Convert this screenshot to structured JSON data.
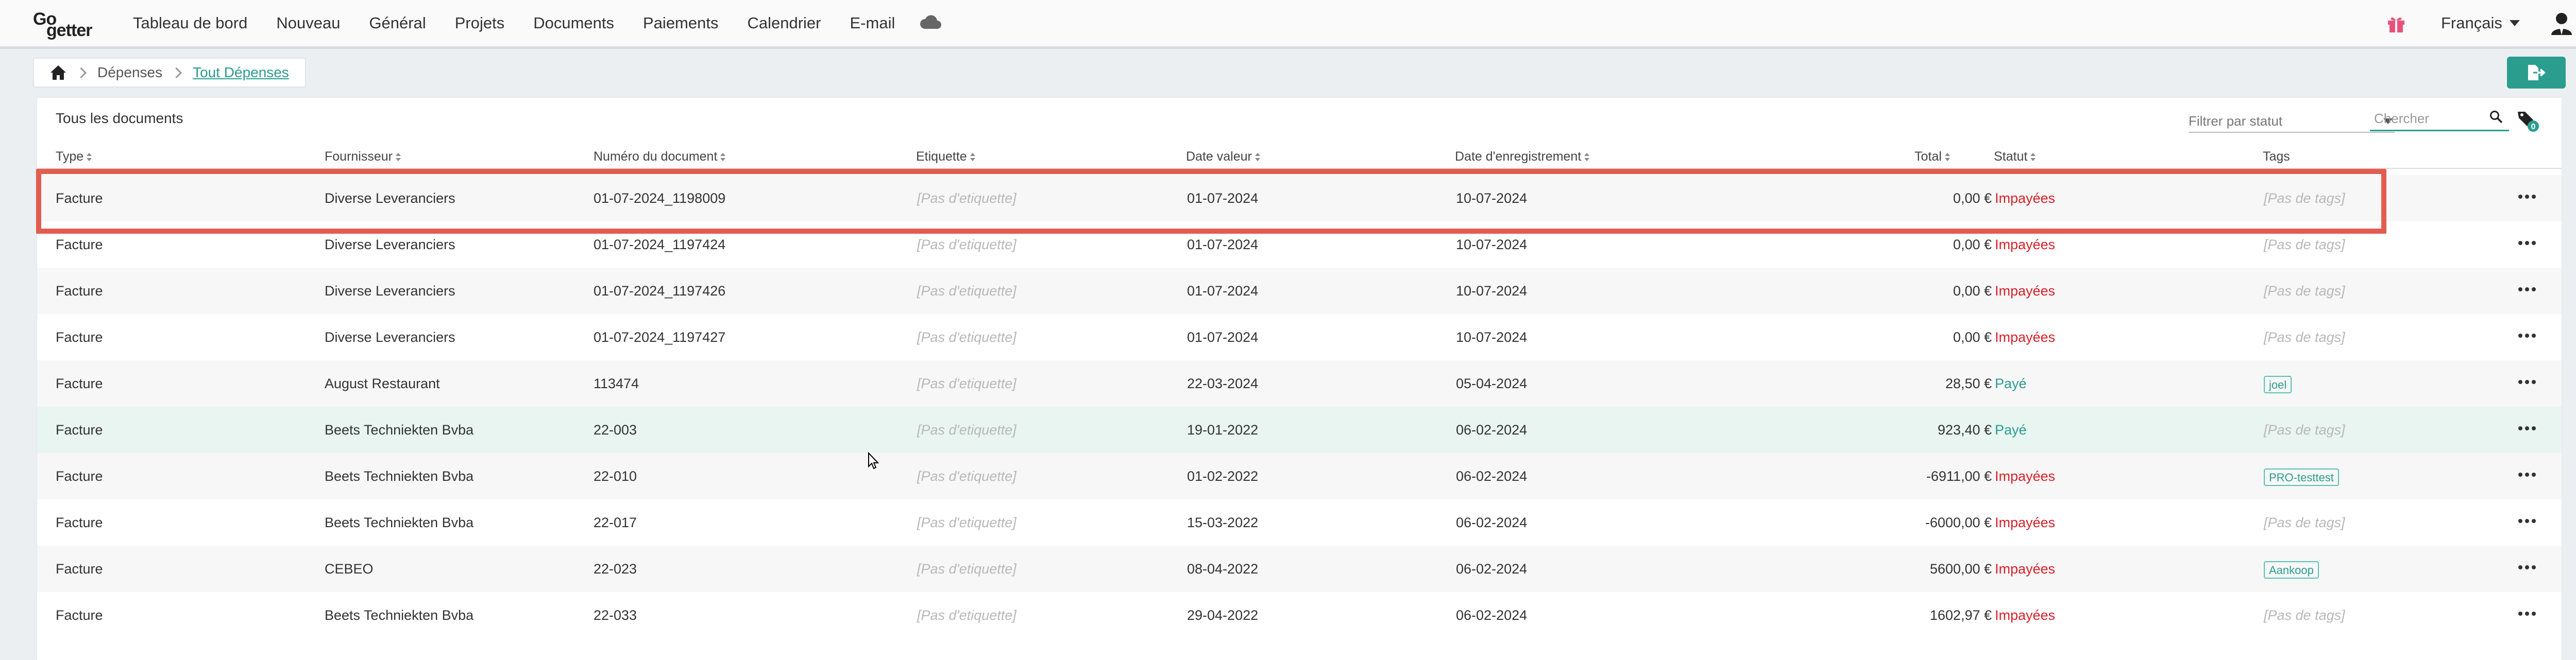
{
  "nav": {
    "logo_top": "Go",
    "logo_bottom": "getter",
    "items": [
      {
        "label": "Tableau de bord"
      },
      {
        "label": "Nouveau"
      },
      {
        "label": "Général"
      },
      {
        "label": "Projets"
      },
      {
        "label": "Documents"
      },
      {
        "label": "Paiements"
      },
      {
        "label": "Calendrier"
      },
      {
        "label": "E-mail"
      }
    ],
    "icons": [
      "cloud-icon",
      "gift-icon",
      "user-icon"
    ],
    "language": "Français"
  },
  "breadcrumb": {
    "icon": "home-icon",
    "items": [
      "Dépenses",
      "Tout Dépenses"
    ]
  },
  "toolbar": {
    "export_icon": "file-export-icon"
  },
  "card": {
    "title": "Tous les documents",
    "filter_placeholder": "Filtrer par statut",
    "search_placeholder": "Chercher",
    "tag_filter_count": "0"
  },
  "table": {
    "columns": [
      "Type",
      "Fournisseur",
      "Numéro du document",
      "Etiquette",
      "Date valeur",
      "Date d'enregistrement",
      "Total",
      "Statut",
      "Tags"
    ],
    "rows": [
      {
        "type": "Facture",
        "supplier": "Diverse Leveranciers",
        "number": "01-07-2024_1198009",
        "label": "[Pas d'etiquette]",
        "value_date": "01-07-2024",
        "reg_date": "10-07-2024",
        "total": "0,00 €",
        "status": "Impayées",
        "status_kind": "unpaid",
        "tags": "[Pas de tags]",
        "tag_chip": false
      },
      {
        "type": "Facture",
        "supplier": "Diverse Leveranciers",
        "number": "01-07-2024_1197424",
        "label": "[Pas d'etiquette]",
        "value_date": "01-07-2024",
        "reg_date": "10-07-2024",
        "total": "0,00 €",
        "status": "Impayées",
        "status_kind": "unpaid",
        "tags": "[Pas de tags]",
        "tag_chip": false
      },
      {
        "type": "Facture",
        "supplier": "Diverse Leveranciers",
        "number": "01-07-2024_1197426",
        "label": "[Pas d'etiquette]",
        "value_date": "01-07-2024",
        "reg_date": "10-07-2024",
        "total": "0,00 €",
        "status": "Impayées",
        "status_kind": "unpaid",
        "tags": "[Pas de tags]",
        "tag_chip": false
      },
      {
        "type": "Facture",
        "supplier": "Diverse Leveranciers",
        "number": "01-07-2024_1197427",
        "label": "[Pas d'etiquette]",
        "value_date": "01-07-2024",
        "reg_date": "10-07-2024",
        "total": "0,00 €",
        "status": "Impayées",
        "status_kind": "unpaid",
        "tags": "[Pas de tags]",
        "tag_chip": false
      },
      {
        "type": "Facture",
        "supplier": "August Restaurant",
        "number": "113474",
        "label": "[Pas d'etiquette]",
        "value_date": "22-03-2024",
        "reg_date": "05-04-2024",
        "total": "28,50 €",
        "status": "Payé",
        "status_kind": "paid",
        "tags": "joel",
        "tag_chip": true
      },
      {
        "type": "Facture",
        "supplier": "Beets Techniekten Bvba",
        "number": "22-003",
        "label": "[Pas d'etiquette]",
        "value_date": "19-01-2022",
        "reg_date": "06-02-2024",
        "total": "923,40 €",
        "status": "Payé",
        "status_kind": "paid",
        "tags": "[Pas de tags]",
        "tag_chip": false
      },
      {
        "type": "Facture",
        "supplier": "Beets Techniekten Bvba",
        "number": "22-010",
        "label": "[Pas d'etiquette]",
        "value_date": "01-02-2022",
        "reg_date": "06-02-2024",
        "total": "-6911,00 €",
        "status": "Impayées",
        "status_kind": "unpaid",
        "tags": "PRO-testtest",
        "tag_chip": true
      },
      {
        "type": "Facture",
        "supplier": "Beets Techniekten Bvba",
        "number": "22-017",
        "label": "[Pas d'etiquette]",
        "value_date": "15-03-2022",
        "reg_date": "06-02-2024",
        "total": "-6000,00 €",
        "status": "Impayées",
        "status_kind": "unpaid",
        "tags": "[Pas de tags]",
        "tag_chip": false
      },
      {
        "type": "Facture",
        "supplier": "CEBEO",
        "number": "22-023",
        "label": "[Pas d'etiquette]",
        "value_date": "08-04-2022",
        "reg_date": "06-02-2024",
        "total": "5600,00 €",
        "status": "Impayées",
        "status_kind": "unpaid",
        "tags": "Aankoop",
        "tag_chip": true
      },
      {
        "type": "Facture",
        "supplier": "Beets Techniekten Bvba",
        "number": "22-033",
        "label": "[Pas d'etiquette]",
        "value_date": "29-04-2022",
        "reg_date": "06-02-2024",
        "total": "1602,97 €",
        "status": "Impayées",
        "status_kind": "unpaid",
        "tags": "[Pas de tags]",
        "tag_chip": false
      }
    ]
  },
  "colors": {
    "accent": "#2a9d8f",
    "unpaid": "#d9202a",
    "highlight_box": "#e25c4f",
    "hover_row": "#e8f5f1"
  }
}
